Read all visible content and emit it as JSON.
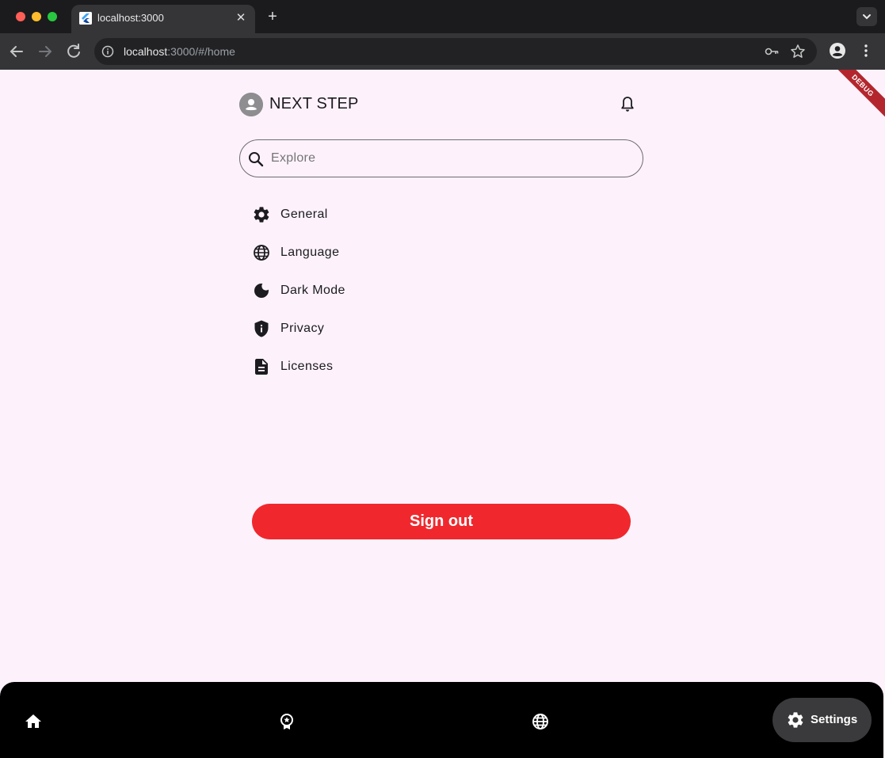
{
  "browser": {
    "tab_title": "localhost:3000",
    "url_host": "localhost",
    "url_rest": ":3000/#/home"
  },
  "app": {
    "title": "NEXT STEP",
    "debug_badge": "DEBUG",
    "search": {
      "placeholder": "Explore",
      "value": ""
    },
    "menu": [
      {
        "label": "General",
        "icon": "gear-icon"
      },
      {
        "label": "Language",
        "icon": "globe-icon"
      },
      {
        "label": "Dark Mode",
        "icon": "moon-icon"
      },
      {
        "label": "Privacy",
        "icon": "shield-info-icon"
      },
      {
        "label": "Licenses",
        "icon": "document-icon"
      }
    ],
    "signout_label": "Sign out",
    "colors": {
      "background": "#fdf2fc",
      "signout": "#f0282d",
      "text": "#1c1b1f"
    }
  },
  "bottom_nav": {
    "items": [
      {
        "icon": "home-icon"
      },
      {
        "icon": "award-icon"
      },
      {
        "icon": "globe-icon"
      },
      {
        "icon": "gear-icon",
        "label": "Settings",
        "selected": true
      }
    ]
  }
}
